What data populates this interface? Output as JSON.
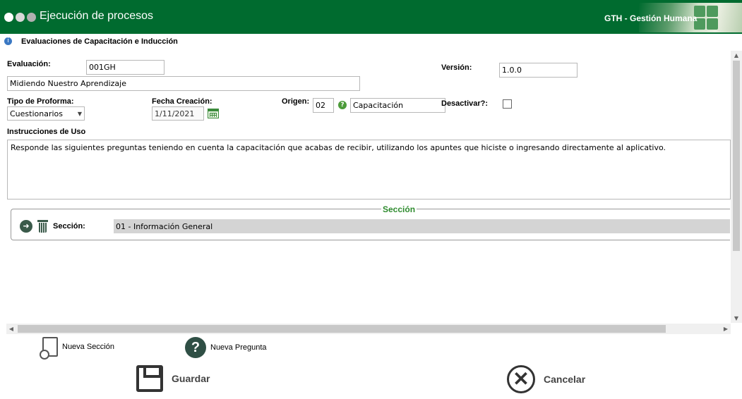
{
  "header": {
    "title": "Ejecución de procesos",
    "module": "GTH - Gestión Humana",
    "dot_colors": [
      "#ffffff",
      "#d8d8d8",
      "#b0b0b0"
    ],
    "brand_color": "#006b2f"
  },
  "page": {
    "title": "Evaluaciones de Capacitación e Inducción"
  },
  "form": {
    "evaluacion_label": "Evaluación:",
    "evaluacion_code": "001GH",
    "evaluacion_name": "Midiendo Nuestro Aprendizaje",
    "version_label": "Versión:",
    "version_value": "1.0.0",
    "tipo_label": "Tipo de Proforma:",
    "tipo_value": "Cuestionarios",
    "fecha_label": "Fecha Creación:",
    "fecha_value": "1/11/2021",
    "origen_label": "Origen:",
    "origen_code": "02",
    "origen_name": "Capacitación",
    "desactivar_label": "Desactivar?:",
    "desactivar_checked": false,
    "instrucciones_label": "Instrucciones de Uso",
    "instrucciones_value": "Responde las siguientes preguntas teniendo en cuenta la capacitación que acabas de recibir, utilizando los apuntes que hiciste o ingresando directamente al aplicativo."
  },
  "section": {
    "legend": "Sección",
    "label": "Sección:",
    "value": "01 - Información General"
  },
  "actions": {
    "nueva_seccion": "Nueva Sección",
    "nueva_pregunta": "Nueva Pregunta",
    "guardar": "Guardar",
    "cancelar": "Cancelar"
  },
  "icons": {
    "calendar": "calendar-icon",
    "help": "help-icon",
    "section_nav": "navigate-icon",
    "trash": "trash-icon",
    "new_section": "new-document-icon",
    "new_question": "question-icon",
    "save": "save-icon",
    "cancel": "cancel-icon"
  }
}
